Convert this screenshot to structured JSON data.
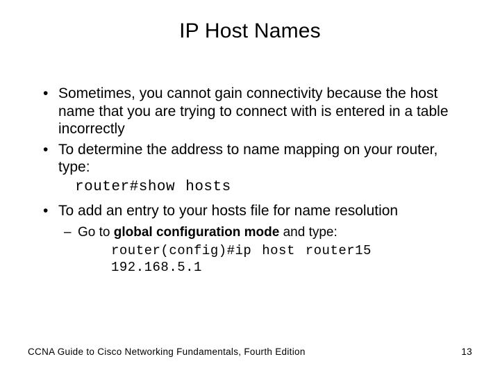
{
  "title": "IP Host Names",
  "bullets": {
    "b1": "Sometimes, you cannot gain connectivity because the host name that you are trying to connect with is entered in a table incorrectly",
    "b2": "To determine the address to name mapping on your router, type:",
    "b2_code": "router#show hosts",
    "b3": "To add an entry to your hosts file for name resolution",
    "b3_sub_prefix": "Go to ",
    "b3_sub_bold": "global configuration mode",
    "b3_sub_suffix": " and type:",
    "b3_code": "router(config)#ip host router15 192.168.5.1"
  },
  "footer": {
    "left": "CCNA Guide to Cisco Networking Fundamentals, Fourth Edition",
    "right": "13"
  }
}
